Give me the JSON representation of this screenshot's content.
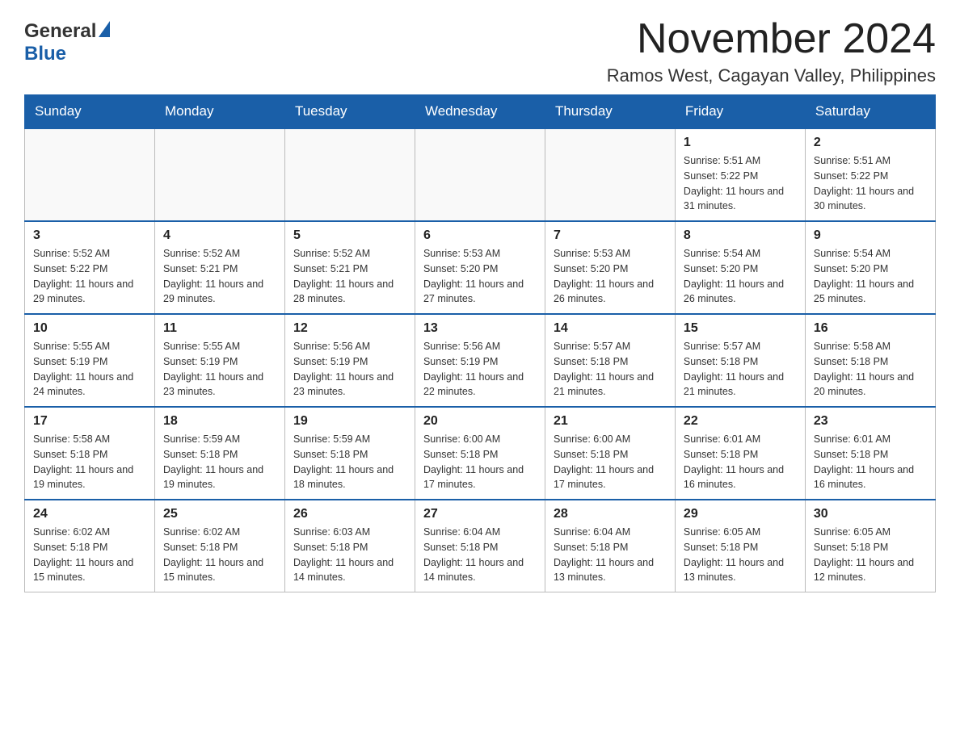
{
  "header": {
    "logo": {
      "general": "General",
      "blue": "Blue"
    },
    "title": "November 2024",
    "subtitle": "Ramos West, Cagayan Valley, Philippines"
  },
  "calendar": {
    "days_of_week": [
      "Sunday",
      "Monday",
      "Tuesday",
      "Wednesday",
      "Thursday",
      "Friday",
      "Saturday"
    ],
    "weeks": [
      [
        {
          "day": "",
          "info": ""
        },
        {
          "day": "",
          "info": ""
        },
        {
          "day": "",
          "info": ""
        },
        {
          "day": "",
          "info": ""
        },
        {
          "day": "",
          "info": ""
        },
        {
          "day": "1",
          "info": "Sunrise: 5:51 AM\nSunset: 5:22 PM\nDaylight: 11 hours and 31 minutes."
        },
        {
          "day": "2",
          "info": "Sunrise: 5:51 AM\nSunset: 5:22 PM\nDaylight: 11 hours and 30 minutes."
        }
      ],
      [
        {
          "day": "3",
          "info": "Sunrise: 5:52 AM\nSunset: 5:22 PM\nDaylight: 11 hours and 29 minutes."
        },
        {
          "day": "4",
          "info": "Sunrise: 5:52 AM\nSunset: 5:21 PM\nDaylight: 11 hours and 29 minutes."
        },
        {
          "day": "5",
          "info": "Sunrise: 5:52 AM\nSunset: 5:21 PM\nDaylight: 11 hours and 28 minutes."
        },
        {
          "day": "6",
          "info": "Sunrise: 5:53 AM\nSunset: 5:20 PM\nDaylight: 11 hours and 27 minutes."
        },
        {
          "day": "7",
          "info": "Sunrise: 5:53 AM\nSunset: 5:20 PM\nDaylight: 11 hours and 26 minutes."
        },
        {
          "day": "8",
          "info": "Sunrise: 5:54 AM\nSunset: 5:20 PM\nDaylight: 11 hours and 26 minutes."
        },
        {
          "day": "9",
          "info": "Sunrise: 5:54 AM\nSunset: 5:20 PM\nDaylight: 11 hours and 25 minutes."
        }
      ],
      [
        {
          "day": "10",
          "info": "Sunrise: 5:55 AM\nSunset: 5:19 PM\nDaylight: 11 hours and 24 minutes."
        },
        {
          "day": "11",
          "info": "Sunrise: 5:55 AM\nSunset: 5:19 PM\nDaylight: 11 hours and 23 minutes."
        },
        {
          "day": "12",
          "info": "Sunrise: 5:56 AM\nSunset: 5:19 PM\nDaylight: 11 hours and 23 minutes."
        },
        {
          "day": "13",
          "info": "Sunrise: 5:56 AM\nSunset: 5:19 PM\nDaylight: 11 hours and 22 minutes."
        },
        {
          "day": "14",
          "info": "Sunrise: 5:57 AM\nSunset: 5:18 PM\nDaylight: 11 hours and 21 minutes."
        },
        {
          "day": "15",
          "info": "Sunrise: 5:57 AM\nSunset: 5:18 PM\nDaylight: 11 hours and 21 minutes."
        },
        {
          "day": "16",
          "info": "Sunrise: 5:58 AM\nSunset: 5:18 PM\nDaylight: 11 hours and 20 minutes."
        }
      ],
      [
        {
          "day": "17",
          "info": "Sunrise: 5:58 AM\nSunset: 5:18 PM\nDaylight: 11 hours and 19 minutes."
        },
        {
          "day": "18",
          "info": "Sunrise: 5:59 AM\nSunset: 5:18 PM\nDaylight: 11 hours and 19 minutes."
        },
        {
          "day": "19",
          "info": "Sunrise: 5:59 AM\nSunset: 5:18 PM\nDaylight: 11 hours and 18 minutes."
        },
        {
          "day": "20",
          "info": "Sunrise: 6:00 AM\nSunset: 5:18 PM\nDaylight: 11 hours and 17 minutes."
        },
        {
          "day": "21",
          "info": "Sunrise: 6:00 AM\nSunset: 5:18 PM\nDaylight: 11 hours and 17 minutes."
        },
        {
          "day": "22",
          "info": "Sunrise: 6:01 AM\nSunset: 5:18 PM\nDaylight: 11 hours and 16 minutes."
        },
        {
          "day": "23",
          "info": "Sunrise: 6:01 AM\nSunset: 5:18 PM\nDaylight: 11 hours and 16 minutes."
        }
      ],
      [
        {
          "day": "24",
          "info": "Sunrise: 6:02 AM\nSunset: 5:18 PM\nDaylight: 11 hours and 15 minutes."
        },
        {
          "day": "25",
          "info": "Sunrise: 6:02 AM\nSunset: 5:18 PM\nDaylight: 11 hours and 15 minutes."
        },
        {
          "day": "26",
          "info": "Sunrise: 6:03 AM\nSunset: 5:18 PM\nDaylight: 11 hours and 14 minutes."
        },
        {
          "day": "27",
          "info": "Sunrise: 6:04 AM\nSunset: 5:18 PM\nDaylight: 11 hours and 14 minutes."
        },
        {
          "day": "28",
          "info": "Sunrise: 6:04 AM\nSunset: 5:18 PM\nDaylight: 11 hours and 13 minutes."
        },
        {
          "day": "29",
          "info": "Sunrise: 6:05 AM\nSunset: 5:18 PM\nDaylight: 11 hours and 13 minutes."
        },
        {
          "day": "30",
          "info": "Sunrise: 6:05 AM\nSunset: 5:18 PM\nDaylight: 11 hours and 12 minutes."
        }
      ]
    ]
  }
}
